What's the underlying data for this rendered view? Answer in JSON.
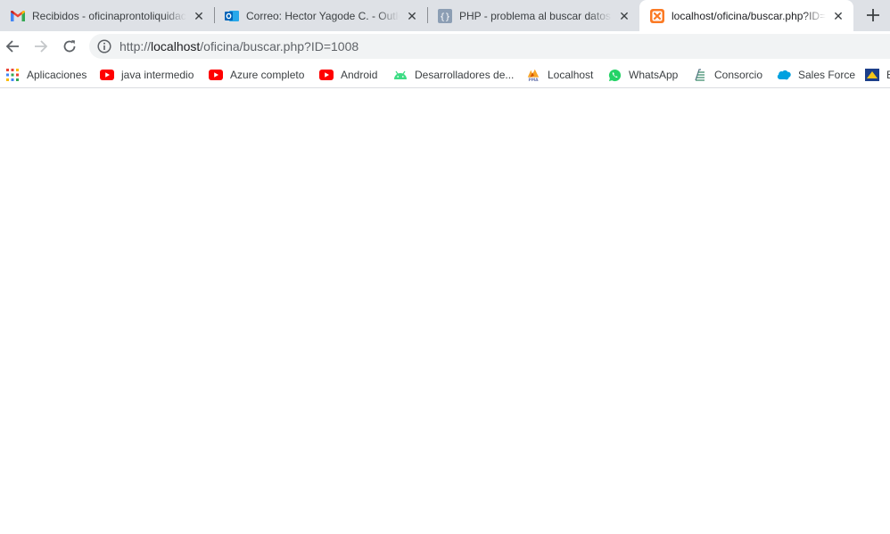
{
  "tabs": [
    {
      "title": "Recibidos - oficinaprontoliquidac",
      "icon": "gmail-icon",
      "active": false
    },
    {
      "title": "Correo: Hector Yagode C. - Outlo",
      "icon": "outlook-icon",
      "active": false
    },
    {
      "title": "PHP - problema al buscar datos",
      "icon": "stackoverflow-icon",
      "active": false
    },
    {
      "title": "localhost/oficina/buscar.php?ID=",
      "icon": "xampp-icon",
      "active": true
    }
  ],
  "omnibox": {
    "url_scheme": "http://",
    "url_host": "localhost",
    "url_path": "/oficina/buscar.php?ID=1008"
  },
  "bookmarks": [
    {
      "label": "Aplicaciones",
      "icon": "apps-grid-icon"
    },
    {
      "label": "java intermedio",
      "icon": "youtube-icon"
    },
    {
      "label": "Azure completo",
      "icon": "youtube-icon"
    },
    {
      "label": "Android",
      "icon": "youtube-icon"
    },
    {
      "label": "Desarrolladores de...",
      "icon": "android-icon"
    },
    {
      "label": "Localhost",
      "icon": "pma-icon"
    },
    {
      "label": "WhatsApp",
      "icon": "whatsapp-icon"
    },
    {
      "label": "Consorcio",
      "icon": "consorcio-icon"
    },
    {
      "label": "Sales Force",
      "icon": "salesforce-icon"
    },
    {
      "label": "E",
      "icon": "bookmark-icon"
    }
  ],
  "colors": {
    "tab_strip": "#dee1e6",
    "omnibox": "#f1f3f4",
    "youtube": "#ff0000",
    "android": "#3ddc84",
    "whatsapp": "#25d366",
    "salesforce": "#00a1e0"
  }
}
